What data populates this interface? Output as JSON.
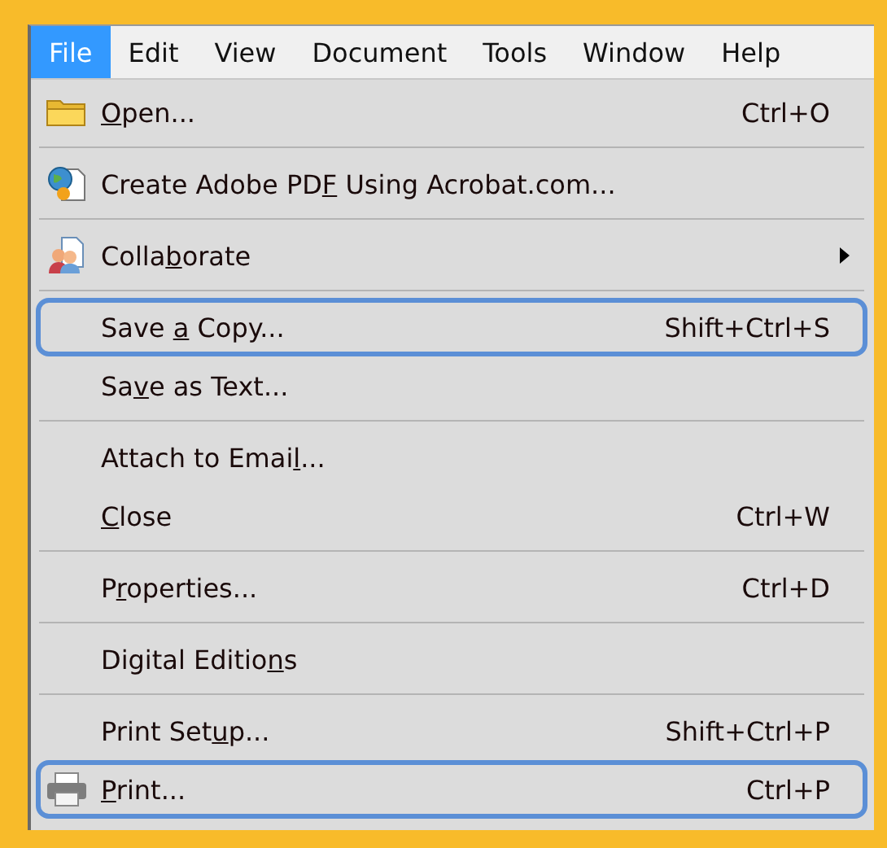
{
  "menu_bar": [
    {
      "label": "File",
      "selected": true
    },
    {
      "label": "Edit",
      "selected": false
    },
    {
      "label": "View",
      "selected": false
    },
    {
      "label": "Document",
      "selected": false
    },
    {
      "label": "Tools",
      "selected": false
    },
    {
      "label": "Window",
      "selected": false
    },
    {
      "label": "Help",
      "selected": false
    }
  ],
  "menu_groups": [
    [
      {
        "key": "O",
        "after": "pen...",
        "shortcut": "Ctrl+O",
        "kind": "folder",
        "submenu": false,
        "highlighted": false
      }
    ],
    [
      {
        "before": "Create Adobe PD",
        "key": "F",
        "after": " Using Acrobat.com...",
        "kind": "globe",
        "submenu": false,
        "highlighted": false
      }
    ],
    [
      {
        "before": "Colla",
        "key": "b",
        "after": "orate",
        "kind": "people",
        "submenu": true,
        "highlighted": false
      }
    ],
    [
      {
        "before": "Save ",
        "key": "a",
        "after": " Copy...",
        "shortcut": "Shift+Ctrl+S",
        "submenu": false,
        "highlighted": true
      },
      {
        "before": "Sa",
        "key": "v",
        "after": "e as Text...",
        "submenu": false,
        "highlighted": false
      }
    ],
    [
      {
        "before": "Attach to Emai",
        "key": "l",
        "after": "...",
        "submenu": false,
        "highlighted": false
      },
      {
        "key": "C",
        "after": "lose",
        "shortcut": "Ctrl+W",
        "submenu": false,
        "highlighted": false
      }
    ],
    [
      {
        "before": "P",
        "key": "r",
        "after": "operties...",
        "shortcut": "Ctrl+D",
        "submenu": false,
        "highlighted": false
      }
    ],
    [
      {
        "before": "Digital Editio",
        "key": "n",
        "after": "s",
        "submenu": false,
        "highlighted": false
      }
    ],
    [
      {
        "before": "Print Set",
        "key": "u",
        "after": "p...",
        "shortcut": "Shift+Ctrl+P",
        "submenu": false,
        "highlighted": false
      },
      {
        "key": "P",
        "after": "rint...",
        "shortcut": "Ctrl+P",
        "kind": "printer",
        "submenu": false,
        "highlighted": true
      }
    ]
  ]
}
